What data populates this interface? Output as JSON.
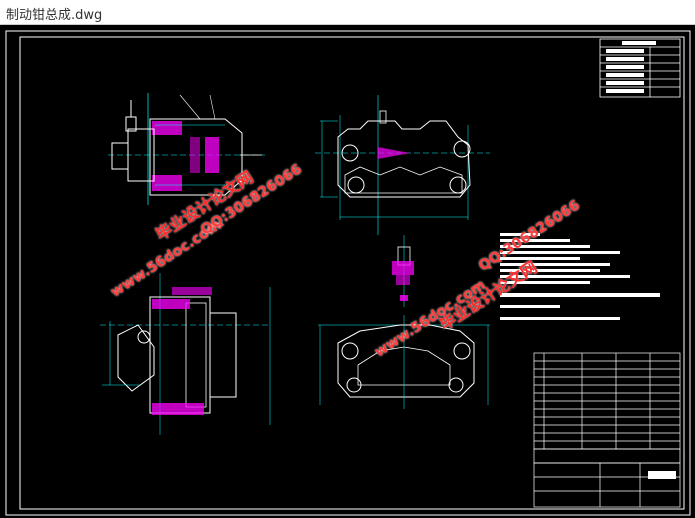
{
  "window": {
    "title": "制动钳总成.dwg"
  },
  "colors": {
    "background": "#000000",
    "frame": "#ffffff",
    "part_lines": "#ffffff",
    "dimension_lines": "#00ffff",
    "section_hatch": "#ff00ff",
    "watermark": "#ff3b3b"
  },
  "watermarks": [
    {
      "text": "www.56doc.com"
    },
    {
      "text": "QQ:306826066"
    },
    {
      "text": "毕业设计论文网"
    }
  ]
}
